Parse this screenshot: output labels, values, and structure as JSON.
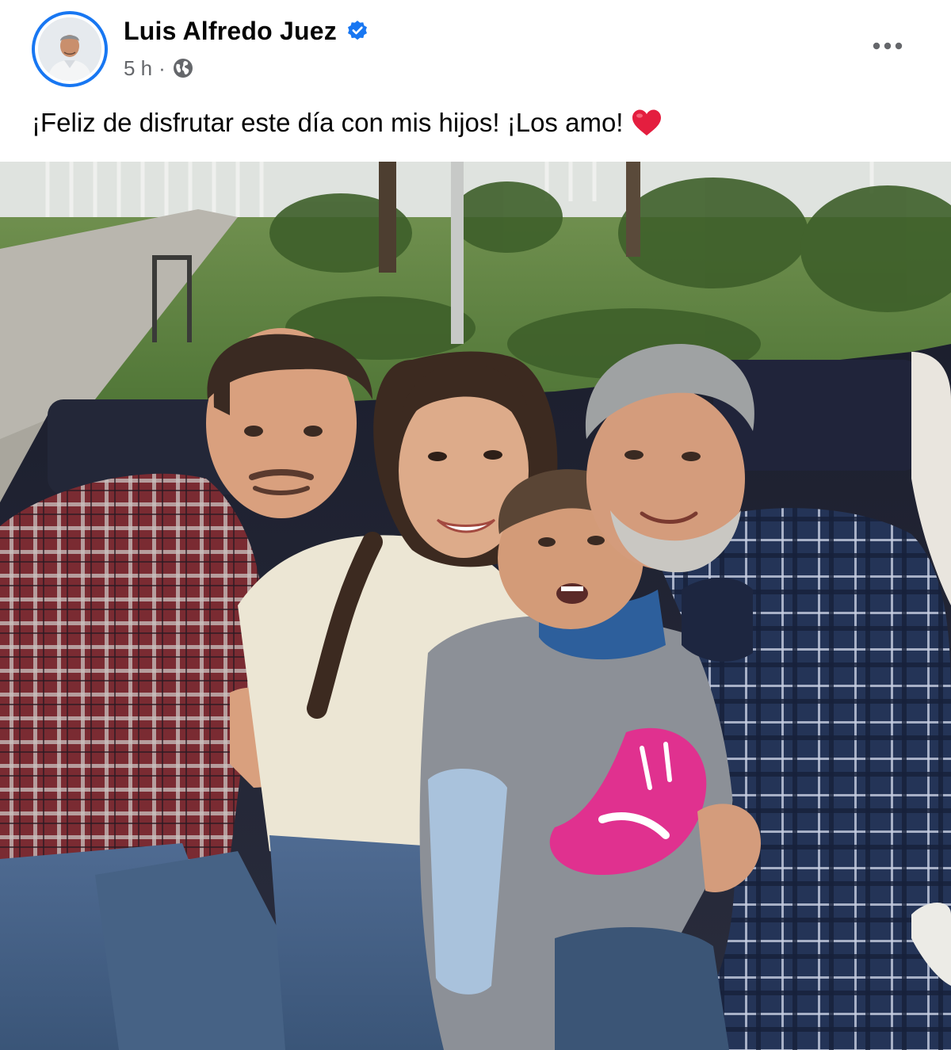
{
  "post": {
    "author_name": "Luis Alfredo Juez",
    "timestamp": "5 h",
    "separator": "·",
    "privacy_icon": "globe-icon",
    "verified_icon": "verified-badge-icon",
    "more_icon": "more-options-icon",
    "text": "¡Feliz de disfrutar este día con mis hijos! ¡Los amo!",
    "emoji_icon": "red-heart-icon"
  },
  "colors": {
    "brand_blue": "#1877f2",
    "secondary_text": "#65676b",
    "heart_red": "#e41e3f"
  }
}
